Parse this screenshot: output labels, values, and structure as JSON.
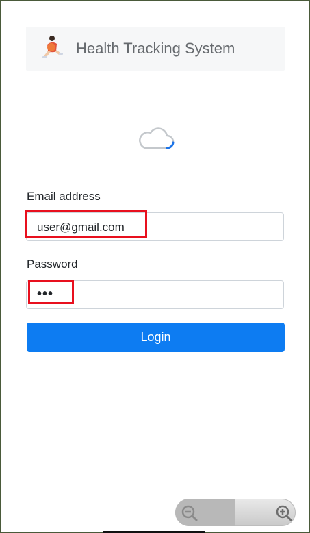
{
  "app": {
    "title": "Health Tracking System",
    "logo_icon": "runner-logo-icon"
  },
  "status": {
    "icon": "cloud-sync-icon"
  },
  "form": {
    "email_label": "Email address",
    "email_value": "user@gmail.com",
    "password_label": "Password",
    "password_value": "•••",
    "login_label": "Login"
  },
  "zoom": {
    "out_icon": "zoom-out-icon",
    "in_icon": "zoom-in-icon"
  },
  "colors": {
    "accent": "#0d7cf2",
    "highlight": "#e8101e",
    "header_bg": "#f6f7f8"
  }
}
